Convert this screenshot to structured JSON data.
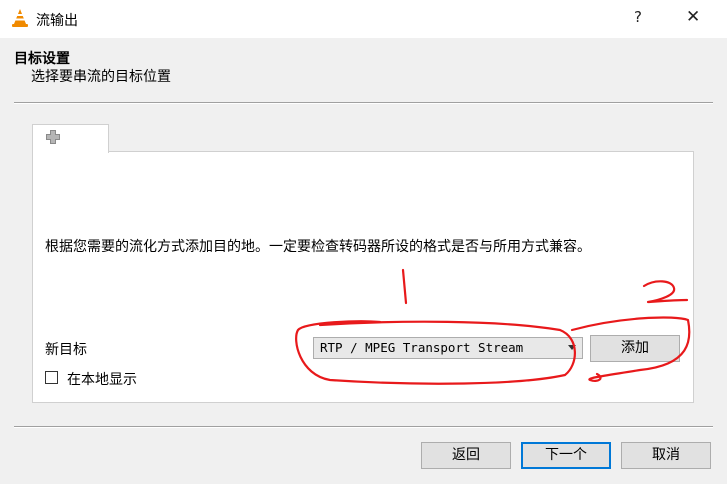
{
  "window": {
    "title": "流输出",
    "help": "?",
    "close": "✕"
  },
  "header": {
    "title": "目标设置",
    "subtitle": "选择要串流的目标位置"
  },
  "panel": {
    "info": "根据您需要的流化方式添加目的地。一定要检查转码器所设的格式是否与所用方式兼容。",
    "new_target_label": "新目标",
    "destination_value": "RTP / MPEG Transport Stream",
    "add_label": "添加",
    "local_display_label": "在本地显示",
    "local_display_checked": false
  },
  "footer": {
    "back": "返回",
    "next": "下一个",
    "cancel": "取消"
  },
  "colors": {
    "accent": "#0078d7",
    "vlc_orange": "#f08a00",
    "annotation": "#e8191b"
  }
}
